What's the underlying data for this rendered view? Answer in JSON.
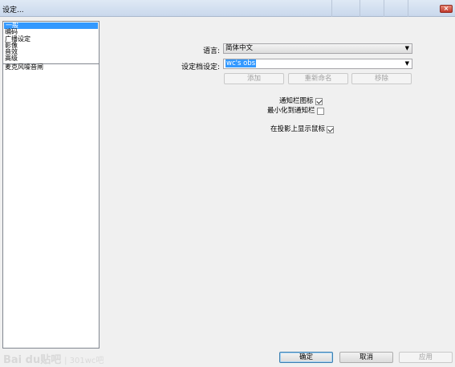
{
  "window": {
    "title": "设定..."
  },
  "sidebar": {
    "items": [
      {
        "label": "一般",
        "selected": true
      },
      {
        "label": "编码",
        "selected": false
      },
      {
        "label": "广播设定",
        "selected": false
      },
      {
        "label": "影像",
        "selected": false
      },
      {
        "label": "音效",
        "selected": false
      },
      {
        "label": "高级",
        "selected": false
      },
      {
        "label": "麦克风噪音闸",
        "selected": false
      }
    ]
  },
  "general": {
    "language_label": "语言:",
    "language_value": "简体中文",
    "profile_label": "设定档设定:",
    "profile_value": "wc's obs",
    "add_button": "添加",
    "rename_button": "重新命名",
    "remove_button": "移除",
    "tray_icon_label": "通知栏图标",
    "tray_icon_checked": true,
    "minimize_to_tray_label": "最小化到通知栏",
    "minimize_to_tray_checked": false,
    "show_cursor_label": "在投影上显示鼠标",
    "show_cursor_checked": true
  },
  "footer": {
    "ok_button": "确定",
    "cancel_button": "取消",
    "apply_button": "应用"
  },
  "watermark": {
    "logo": "Bai du贴吧",
    "sub": "| 301wc吧"
  }
}
